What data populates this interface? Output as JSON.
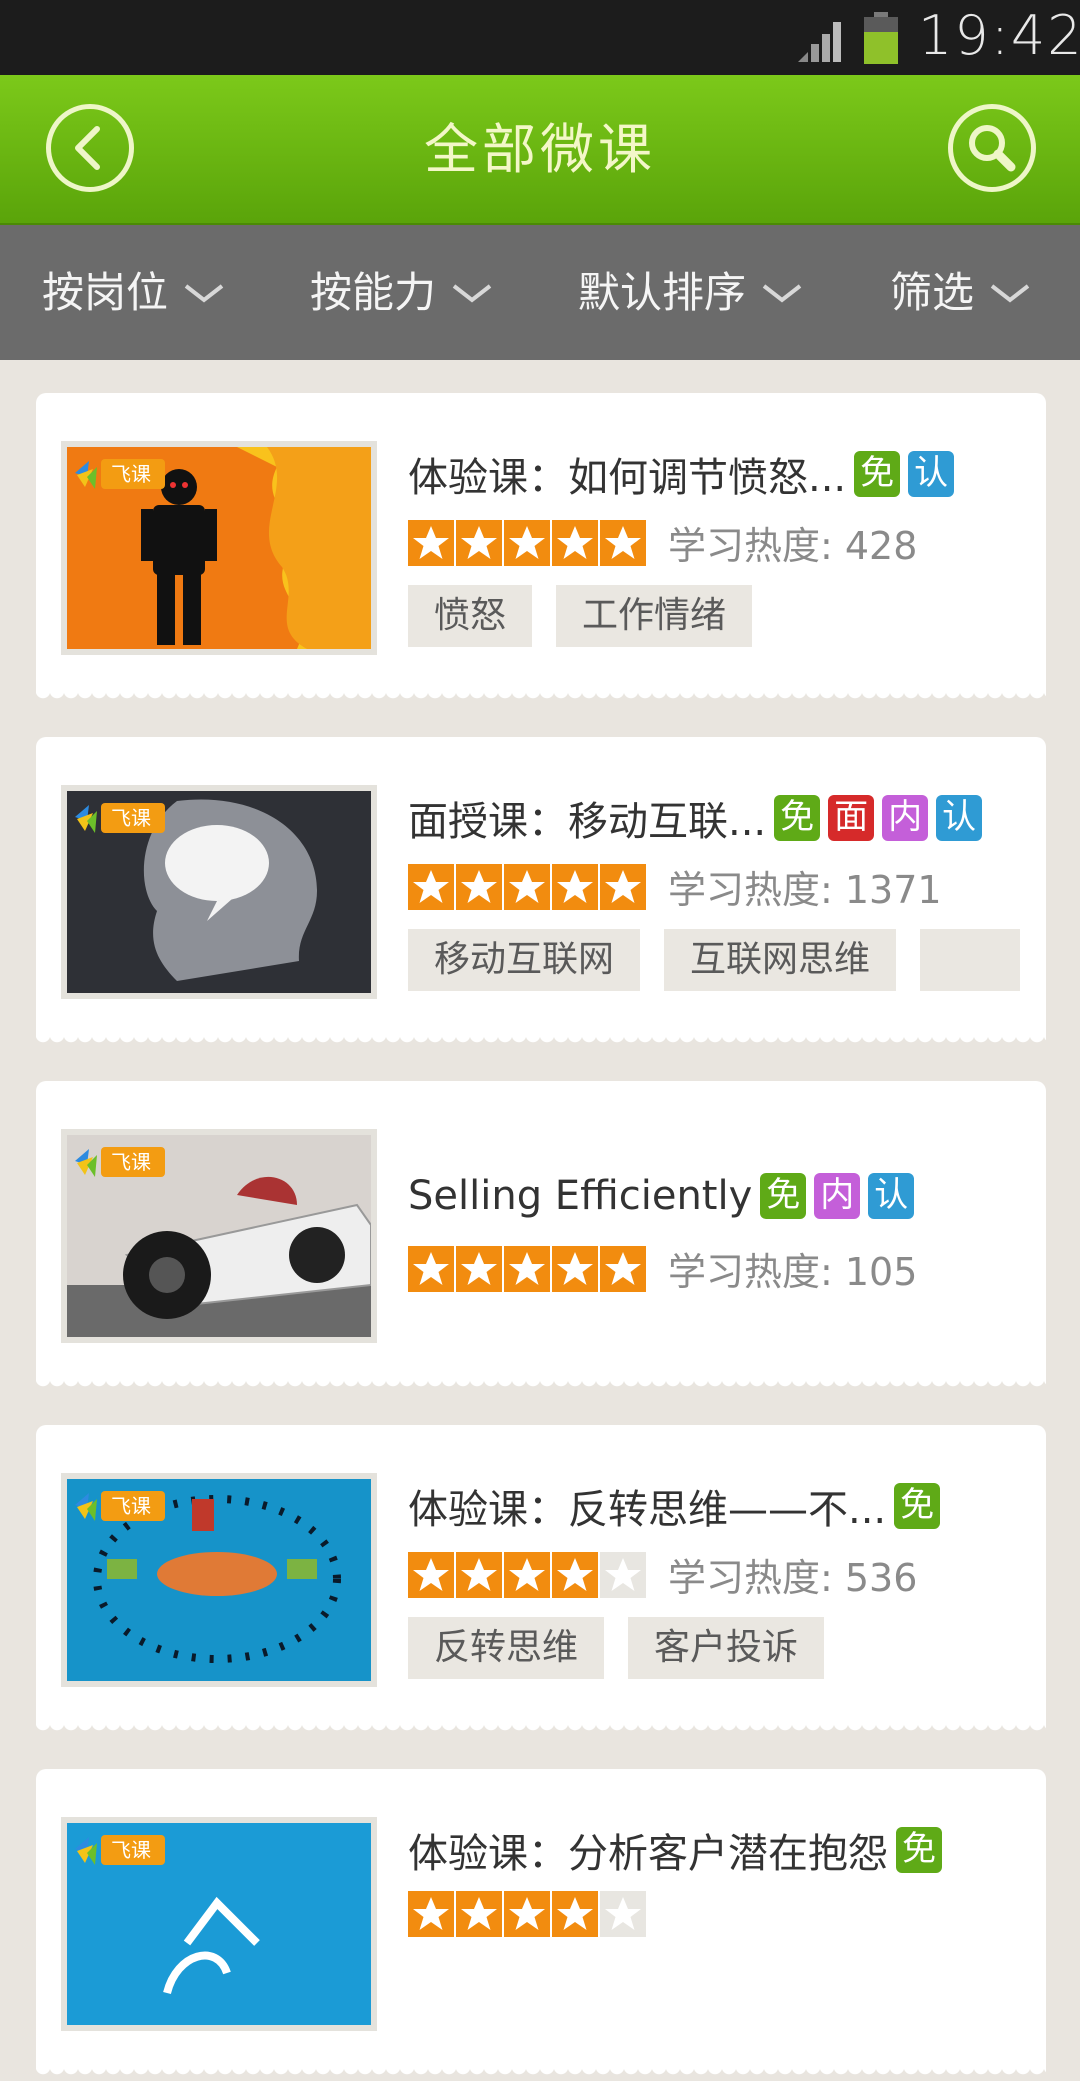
{
  "status_bar": {
    "time": "19:42"
  },
  "header": {
    "title": "全部微课"
  },
  "filters": [
    {
      "label": "按岗位"
    },
    {
      "label": "按能力"
    },
    {
      "label": "默认排序"
    },
    {
      "label": "筛选"
    }
  ],
  "courses": [
    {
      "title": "体验课：如何调节愤怒...",
      "badges": [
        "免",
        "认"
      ],
      "rating": 5,
      "heat_label": "学习热度: 428",
      "tags": [
        "愤怒",
        "工作情绪"
      ]
    },
    {
      "title": "面授课：移动互联...",
      "badges": [
        "免",
        "面",
        "内",
        "认"
      ],
      "rating": 5,
      "heat_label": "学习热度: 1371",
      "tags": [
        "移动互联网",
        "互联网思维",
        ""
      ]
    },
    {
      "title": "Selling Efficiently",
      "badges": [
        "免",
        "内",
        "认"
      ],
      "rating": 5,
      "heat_label": "学习热度: 105",
      "tags": []
    },
    {
      "title": "体验课：反转思维——不...",
      "badges": [
        "免"
      ],
      "rating": 4,
      "heat_label": "学习热度: 536",
      "tags": [
        "反转思维",
        "客户投诉"
      ]
    },
    {
      "title": "体验课：分析客户潜在抱怨",
      "badges": [
        "免"
      ],
      "rating": 4,
      "heat_label": "",
      "tags": []
    }
  ],
  "thumb_logo": "飞课",
  "colors": {
    "header_green": "#6cba12",
    "star_orange": "#f28c0f",
    "badge_free": "#5faa17",
    "badge_face": "#d62a2a",
    "badge_inner": "#c45fd9",
    "badge_cert": "#2f9bd4"
  }
}
